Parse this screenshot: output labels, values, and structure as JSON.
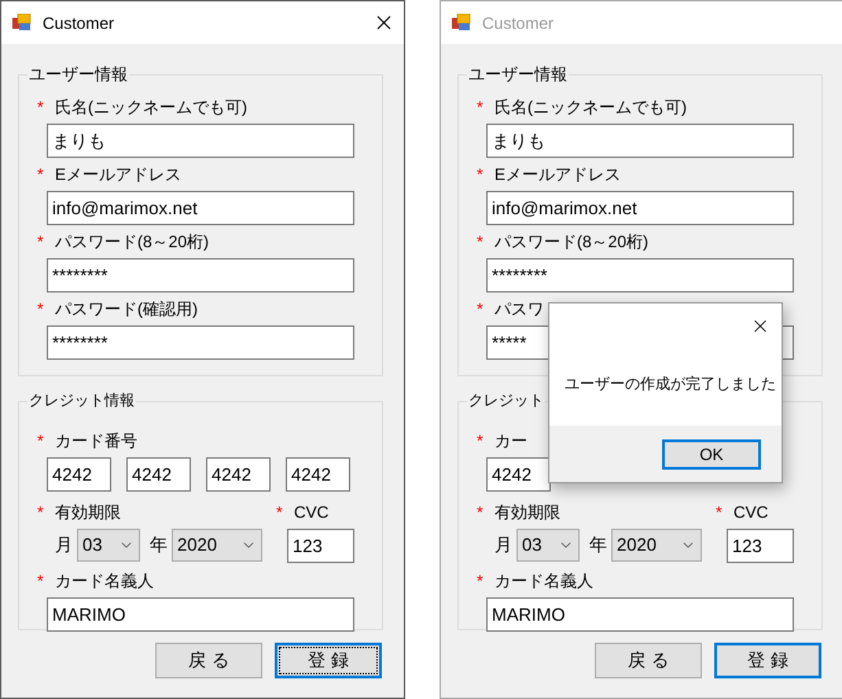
{
  "windows": [
    {
      "title": "Customer",
      "active": true,
      "has_close": true,
      "user_group": {
        "title": "ユーザー情報",
        "fields": [
          {
            "mark": "*",
            "label": "氏名(ニックネームでも可)",
            "value": "まりも"
          },
          {
            "mark": "*",
            "label": "Eメールアドレス",
            "value": "info@marimox.net"
          },
          {
            "mark": "*",
            "label": "パスワード(8～20桁)",
            "value": "********"
          },
          {
            "mark": "*",
            "label": "パスワード(確認用)",
            "value": "********"
          }
        ]
      },
      "credit_group": {
        "title": "クレジット情報",
        "card": {
          "mark": "*",
          "label": "カード番号",
          "numbers": [
            "4242",
            "4242",
            "4242",
            "4242"
          ]
        },
        "expiry": {
          "mark": "*",
          "label": "有効期限",
          "month_label": "月",
          "month": "03",
          "year_label": "年",
          "year": "2020"
        },
        "cvc": {
          "mark": "*",
          "label": "CVC",
          "value": "123"
        },
        "holder": {
          "mark": "*",
          "label": "カード名義人",
          "value": "MARIMO"
        }
      },
      "buttons": [
        {
          "label": "戻 る",
          "default": false,
          "focused": false
        },
        {
          "label": "登 録",
          "default": true,
          "focused": true
        }
      ]
    },
    {
      "title": "Customer",
      "active": false,
      "has_close": false,
      "user_group": {
        "title": "ユーザー情報",
        "fields": [
          {
            "mark": "*",
            "label": "氏名(ニックネームでも可)",
            "value": "まりも"
          },
          {
            "mark": "*",
            "label": "Eメールアドレス",
            "value": "info@marimox.net"
          },
          {
            "mark": "*",
            "label": "パスワード(8～20桁)",
            "value": "********"
          },
          {
            "mark": "*",
            "label": "パスワ",
            "value": "*****"
          }
        ]
      },
      "credit_group": {
        "title": "クレジット",
        "card": {
          "mark": "*",
          "label": "カー",
          "numbers": [
            "4242"
          ]
        },
        "expiry": {
          "mark": "*",
          "label": "有効期限",
          "month_label": "月",
          "month": "03",
          "year_label": "年",
          "year": "2020"
        },
        "cvc": {
          "mark": "*",
          "label": "CVC",
          "value": "123"
        },
        "holder": {
          "mark": "*",
          "label": "カード名義人",
          "value": "MARIMO"
        }
      },
      "buttons": [
        {
          "label": "戻 る",
          "default": false,
          "focused": false
        },
        {
          "label": "登 録",
          "default": true,
          "focused": false
        }
      ],
      "message_box": {
        "message": "ユーザーの作成が完了しました",
        "has_close": true,
        "button": "OK"
      }
    }
  ]
}
